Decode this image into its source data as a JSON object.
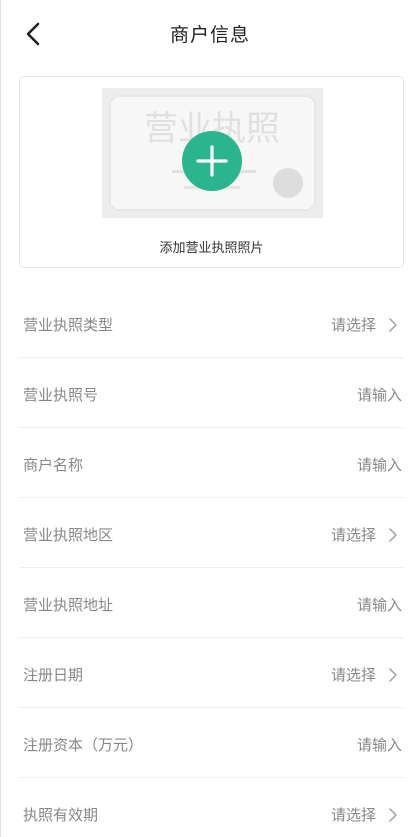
{
  "header": {
    "title": "商户信息"
  },
  "upload": {
    "watermark": "营业执照",
    "label": "添加营业执照照片"
  },
  "form": {
    "rows": [
      {
        "label": "营业执照类型",
        "value": "请选择",
        "type": "select"
      },
      {
        "label": "营业执照号",
        "value": "请输入",
        "type": "input"
      },
      {
        "label": "商户名称",
        "value": "请输入",
        "type": "input"
      },
      {
        "label": "营业执照地区",
        "value": "请选择",
        "type": "select"
      },
      {
        "label": "营业执照地址",
        "value": "请输入",
        "type": "input"
      },
      {
        "label": "注册日期",
        "value": "请选择",
        "type": "select"
      },
      {
        "label": "注册资本（万元）",
        "value": "请输入",
        "type": "input"
      },
      {
        "label": "执照有效期",
        "value": "请选择",
        "type": "select"
      }
    ]
  },
  "colors": {
    "accent": "#2bb58f",
    "label": "#888888",
    "divider": "#f0f0f0"
  },
  "icons": {
    "back": "chevron-left-icon",
    "add": "plus-icon",
    "select": "chevron-right-icon"
  }
}
